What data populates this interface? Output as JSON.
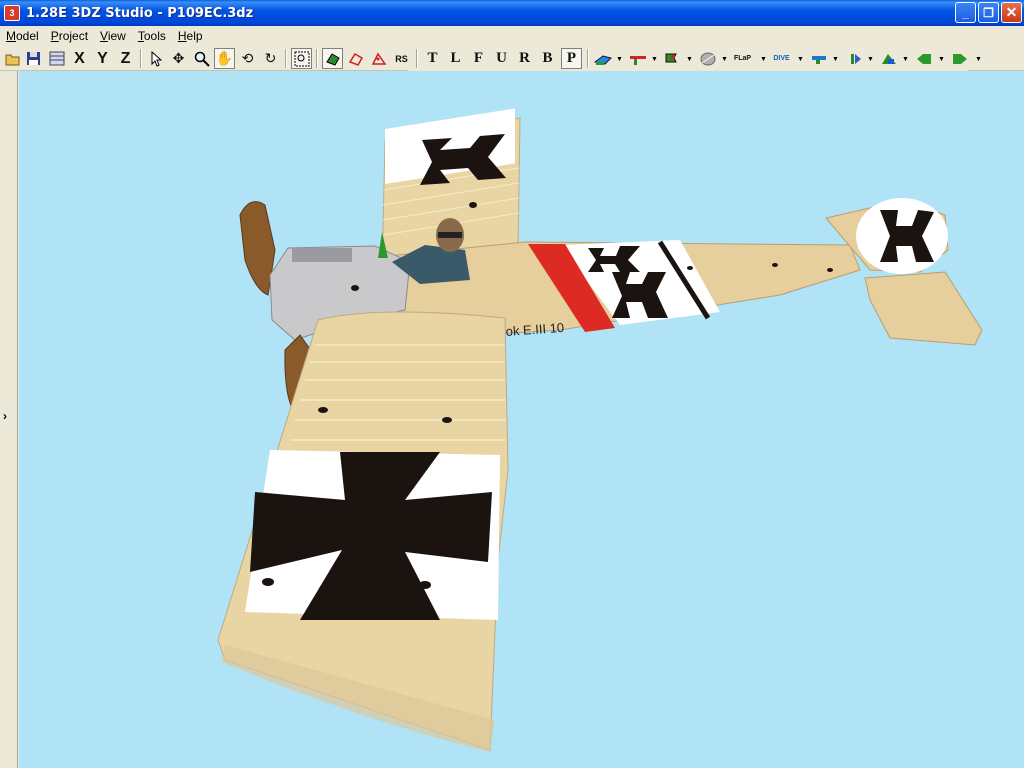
{
  "window": {
    "title": "1.28E 3DZ Studio - P109EC.3dz",
    "app_icon": "3dz-app-icon",
    "minimize": "_",
    "maximize": "❐",
    "close": "✕"
  },
  "menu": [
    "Model",
    "Project",
    "View",
    "Tools",
    "Help"
  ],
  "toolbar": {
    "axis_x": "X",
    "axis_y": "Y",
    "axis_z": "Z",
    "rs": "RS",
    "letters": [
      "T",
      "L",
      "F",
      "U",
      "R",
      "B",
      "P"
    ]
  },
  "aircraft_marking": "ok E.III 10",
  "colors": {
    "viewport_bg": "#b1e3f7",
    "title_bar": "#0055e5",
    "wing": "#e9d4a4",
    "cross": "#1a1310",
    "red_band": "#dd2a22"
  }
}
